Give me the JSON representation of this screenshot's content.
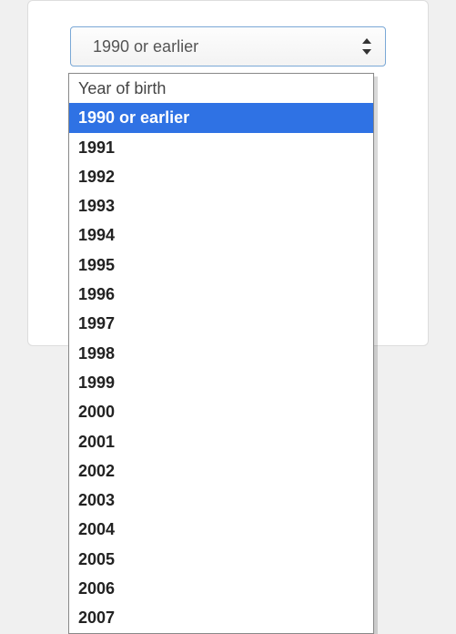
{
  "select": {
    "current_value": "1990 or earlier",
    "placeholder_option": "Year of birth",
    "selected_index": 1,
    "options": [
      "Year of birth",
      "1990 or earlier",
      "1991",
      "1992",
      "1993",
      "1994",
      "1995",
      "1996",
      "1997",
      "1998",
      "1999",
      "2000",
      "2001",
      "2002",
      "2003",
      "2004",
      "2005",
      "2006",
      "2007"
    ]
  }
}
